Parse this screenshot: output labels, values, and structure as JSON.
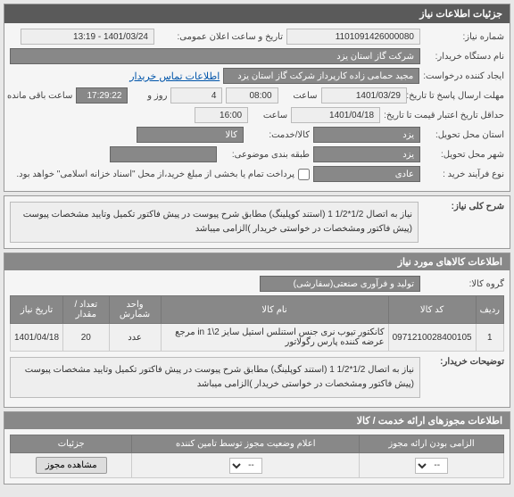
{
  "panel1": {
    "title": "جزئیات اطلاعات نیاز",
    "need_number_label": "شماره نیاز:",
    "need_number": "1101091426000080",
    "announce_label": "تاریخ و ساعت اعلان عمومی:",
    "announce_value": "1401/03/24 - 13:19",
    "buyer_label": "نام دستگاه خریدار:",
    "buyer_value": "شرکت گاز استان یزد",
    "requester_label": "ایجاد کننده درخواست:",
    "requester_value": "مجید حمامی زاده کارپرداز شرکت گاز استان یزد",
    "contact_link": "اطلاعات تماس خریدار",
    "deadline_label": "مهلت ارسال پاسخ تا تاریخ:",
    "deadline_date": "1401/03/29",
    "time_label": "ساعت",
    "deadline_time": "08:00",
    "days_label": "روز و",
    "days_value": "4",
    "remaining_time": "17:29:22",
    "remaining_label": "ساعت باقی مانده",
    "min_validity_label": "حداقل تاریخ اعتبار قیمت تا تاریخ:",
    "min_validity_date": "1401/04/18",
    "min_validity_time": "16:00",
    "delivery_place_label": "استان محل تحویل:",
    "delivery_place": "یزد",
    "item_type_label": "کالا/خدمت:",
    "item_type": "کالا",
    "delivery_city_label": "شهر محل تحویل:",
    "delivery_city": "یزد",
    "city_important_label": "طبقه بندی موضوعی:",
    "city_important": "",
    "buy_process_label": "نوع فرآیند خرید :",
    "buy_process": "عادی",
    "payment_note": "پرداخت تمام یا بخشی از مبلغ خرید،از محل \"اسناد خزانه اسلامی\" خواهد بود.",
    "checkbox_checked": false
  },
  "desc_section": {
    "label": "شرح کلی نیاز:",
    "text": "نیاز به اتصال 1/2*1/2 1 (استند کوپلینگ) مطابق شرح پیوست در پیش فاکتور تکمیل وتایید مشخصات پیوست (پیش فاکتور ومشخصات در خواستی خریدار )الزامی میباشد"
  },
  "items_section": {
    "title": "اطلاعات کالاهای مورد نیاز",
    "group_label": "گروه کالا:",
    "group_value": "تولید و فرآوری صنعتی(سفارشی)",
    "headers": {
      "row": "ردیف",
      "code": "کد کالا",
      "name": "نام کالا",
      "unit": "واحد شمارش",
      "qty": "تعداد / مقدار",
      "date": "تاریخ نیاز"
    },
    "rows": [
      {
        "idx": "1",
        "code": "0971210028400105",
        "name": "کانکتور تیوب نری جنس استنلس استیل سایز 2\\1 in مرجع عرضه کننده پارس رگولاتور",
        "unit": "عدد",
        "qty": "20",
        "date": "1401/04/18"
      }
    ],
    "buyer_notes_label": "توضیحات خریدار:",
    "buyer_notes": "نیاز به اتصال 1/2*1/2 1 (استند کوپلینگ) مطابق شرح پیوست در پیش فاکتور تکمیل وتایید مشخصات پیوست (پیش فاکتور ومشخصات در خواستی خریدار )الزامی میباشد"
  },
  "permits_section": {
    "title": "اطلاعات مجوزهای ارائه خدمت / کالا",
    "headers": {
      "mandatory": "الزامی بودن ارائه مجوز",
      "status": "اعلام وضعیت مجوز توسط تامین کننده",
      "details": "جزئیات"
    },
    "select_placeholder": "--",
    "view_btn": "مشاهده مجوز"
  }
}
